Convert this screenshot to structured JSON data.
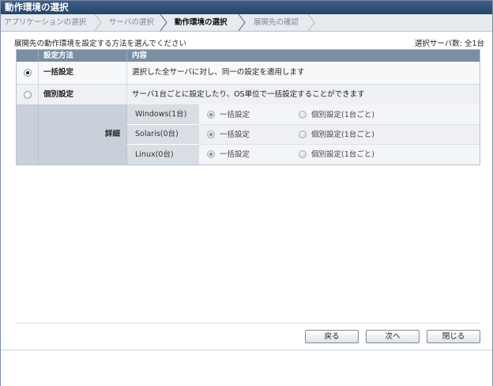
{
  "window": {
    "title": "動作環境の選択"
  },
  "steps": [
    {
      "label": "アプリケーションの選択",
      "active": false
    },
    {
      "label": "サーバの選択",
      "active": false
    },
    {
      "label": "動作環境の選択",
      "active": true
    },
    {
      "label": "展開先の確認",
      "active": false
    }
  ],
  "instruction": "展開先の動作環境を設定する方法を選んでください",
  "selected_count": "選択サーバ数: 全1台",
  "table": {
    "headers": {
      "method": "設定方法",
      "content": "内容"
    },
    "options": [
      {
        "label": "一括設定",
        "description": "選択した全サーバに対し、同一の設定を適用します",
        "selected": true
      },
      {
        "label": "個別設定",
        "description": "サーバ1台ごとに設定したり、OS単位で一括設定することができます",
        "selected": false
      }
    ],
    "detail_label": "詳細",
    "os_rows": [
      {
        "name": "Windows(1台)",
        "opt_all": "一括設定",
        "opt_each": "個別設定(1台ごと)"
      },
      {
        "name": "Solaris(0台)",
        "opt_all": "一括設定",
        "opt_each": "個別設定(1台ごと)"
      },
      {
        "name": "Linux(0台)",
        "opt_all": "一括設定",
        "opt_each": "個別設定(1台ごと)"
      }
    ]
  },
  "buttons": {
    "back": "戻る",
    "next": "次へ",
    "close": "閉じる"
  }
}
